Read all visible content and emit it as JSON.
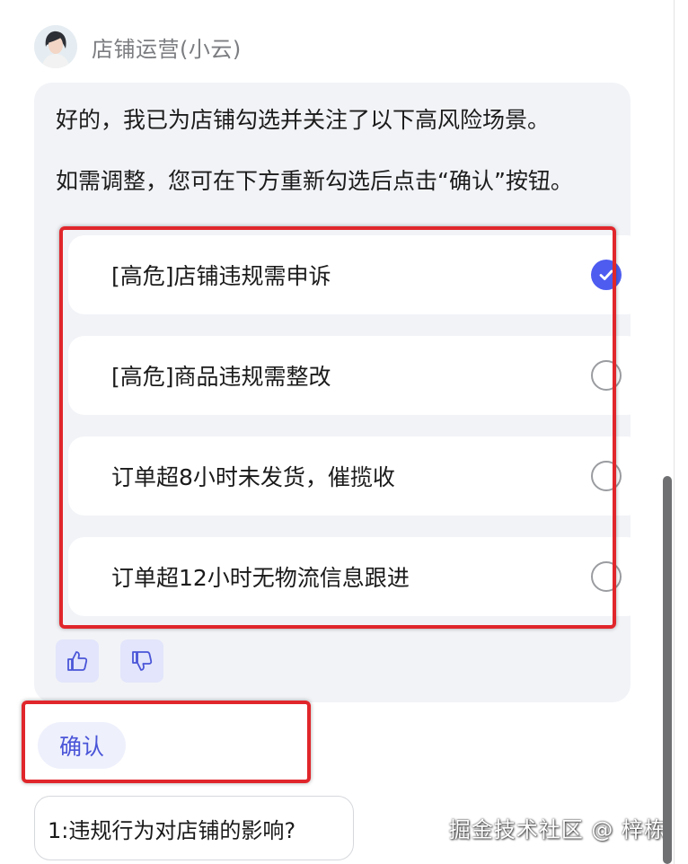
{
  "header": {
    "agent_name": "店铺运营(小云)"
  },
  "message": {
    "line1": "好的，我已为店铺勾选并关注了以下高风险场景。",
    "line2": "如需调整，您可在下方重新勾选后点击“确认”按钮。"
  },
  "options": [
    {
      "label": "[高危]店铺违规需申诉",
      "checked": true
    },
    {
      "label": "[高危]商品违规需整改",
      "checked": false
    },
    {
      "label": "订单超8小时未发货，催揽收",
      "checked": false
    },
    {
      "label": "订单超12小时无物流信息跟进",
      "checked": false
    }
  ],
  "actions": {
    "confirm_label": "确认"
  },
  "suggestions": [
    {
      "label": "1:违规行为对店铺的影响?"
    }
  ],
  "watermark": "掘金技术社区 @ 梓栋",
  "colors": {
    "accent": "#4e5cf0",
    "highlight_border": "#e0262b",
    "bubble_bg": "#f2f3f7"
  }
}
